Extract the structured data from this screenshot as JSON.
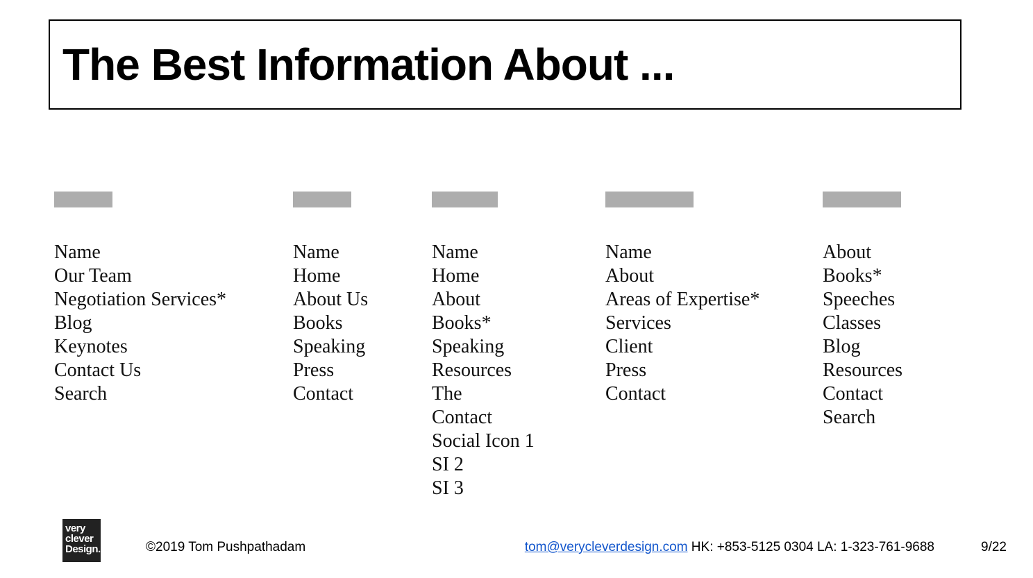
{
  "title": "The Best Information About ...",
  "columns": [
    {
      "items": [
        "Name",
        "Our Team",
        "Negotiation Services*",
        "Blog",
        "Keynotes",
        "Contact Us",
        "Search"
      ]
    },
    {
      "items": [
        "Name",
        "Home",
        "About Us",
        "Books",
        "Speaking",
        "Press",
        "Contact"
      ]
    },
    {
      "items": [
        "Name",
        "Home",
        "About",
        "Books*",
        "Speaking",
        "Resources",
        "The",
        "Contact",
        "Social Icon 1",
        "SI 2",
        "SI 3"
      ]
    },
    {
      "items": [
        "Name",
        "About",
        "Areas of Expertise*",
        "Services",
        "Client",
        "Press",
        "Contact"
      ]
    },
    {
      "items": [
        "About",
        "Books*",
        "Speeches",
        "Classes",
        "Blog",
        "Resources",
        "Contact",
        "Search"
      ]
    }
  ],
  "logo": {
    "line1": "very",
    "line2": "clever",
    "line3": "Design."
  },
  "copyright": "©2019 Tom Pushpathadam",
  "contact_email": "tom@verycleverdesign.com",
  "contact_rest": " HK: +853-5125 0304 LA: 1-323-761-9688",
  "page_num": "9/22"
}
